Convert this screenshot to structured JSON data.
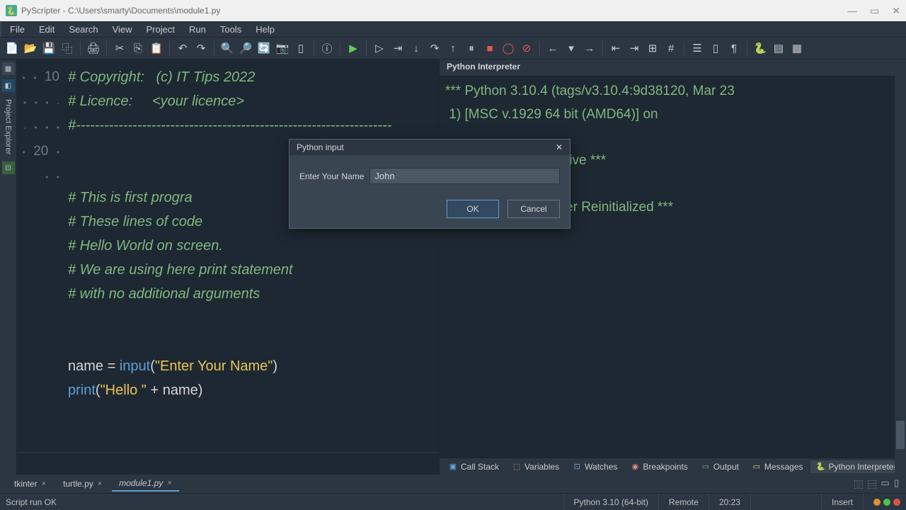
{
  "window": {
    "title": "PyScripter - C:\\Users\\smarty\\Documents\\module1.py"
  },
  "menu": {
    "file": "File",
    "edit": "Edit",
    "search": "Search",
    "view": "View",
    "project": "Project",
    "run": "Run",
    "tools": "Tools",
    "help": "Help"
  },
  "sidepanel": {
    "label": "Project Explorer"
  },
  "code_lines": [
    "# Copyright:   (c) IT Tips 2022",
    "# Licence:     <your licence>",
    "#-------------------------------------------------------------------",
    "",
    "",
    "# This is first progra",
    "# These lines of code",
    "# Hello World on screen.",
    "# We are using here print statement",
    "# with no additional arguments",
    "",
    "",
    "name = input(\"Enter Your Name\")",
    "print(\"Hello \" + name)"
  ],
  "code_line_numbers": {
    "l10": "10",
    "l20": "20"
  },
  "interpreter": {
    "title": "Python Interpreter",
    "line1": "*** Python 3.10.4 (tags/v3.10.4:9d38120, Mar 23",
    "line2": " 1) [MSC v.1929 64 bit (AMD64)] on",
    "line3": "",
    "line4": "     thon engine is active ***",
    "prompt": ">>>",
    "line5": "*** Remote Interpreter Reinitialized ***"
  },
  "bottomtabs": {
    "callstack": "Call Stack",
    "variables": "Variables",
    "watches": "Watches",
    "breakpoints": "Breakpoints",
    "output": "Output",
    "messages": "Messages",
    "interpreter": "Python Interpreter"
  },
  "filetabs": {
    "tkinter": "tkinter",
    "turtle": "turtle.py",
    "module1": "module1.py"
  },
  "dialog": {
    "title": "Python input",
    "label": "Enter Your Name",
    "value": "John",
    "ok": "OK",
    "cancel": "Cancel"
  },
  "status": {
    "msg": "Script run OK",
    "py": "Python 3.10 (64-bit)",
    "mode": "Remote",
    "time": "20:23",
    "ins": "Insert"
  }
}
